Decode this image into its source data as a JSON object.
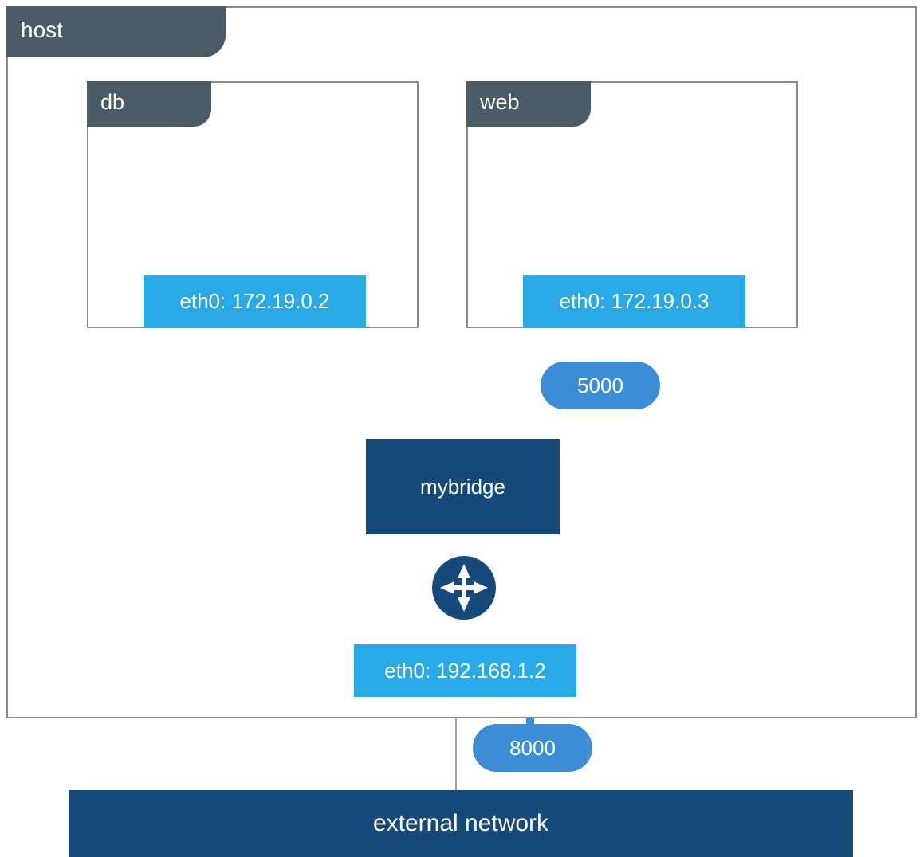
{
  "host": {
    "label": "host"
  },
  "containers": {
    "db": {
      "label": "db",
      "iface_label": "eth0: 172.19.0.2"
    },
    "web": {
      "label": "web",
      "iface_label": "eth0: 172.19.0.3"
    }
  },
  "bridge": {
    "label": "mybridge"
  },
  "host_iface": {
    "label": "eth0: 192.168.1.2"
  },
  "ports": {
    "web": "5000",
    "host": "8000"
  },
  "external": {
    "label": "external network"
  },
  "colors": {
    "tab_bg": "#4a5b68",
    "iface_bg": "#29a9e8",
    "dark_blue": "#164a7a",
    "port_blue": "#3d8dd6",
    "border_grey": "#8a8a8a"
  }
}
